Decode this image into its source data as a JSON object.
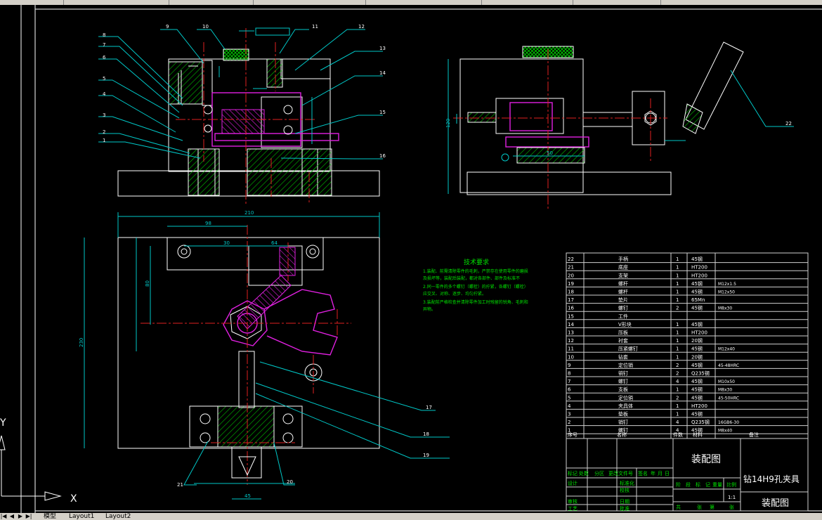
{
  "window": {
    "tabs": [
      "模型",
      "Layout1",
      "Layout2"
    ],
    "nav_arrows": [
      "|◀",
      "◀",
      "▶",
      "▶|"
    ]
  },
  "ucs": {
    "x_label": "X",
    "y_label": "Y"
  },
  "drawing": {
    "balloons_left": [
      "8",
      "7",
      "6",
      "5",
      "4",
      "3",
      "2",
      "1"
    ],
    "balloons_top": [
      "9",
      "10",
      "11",
      "12"
    ],
    "balloons_right": [
      "13",
      "14",
      "15",
      "16"
    ],
    "balloons_plan_right": [
      "17",
      "18",
      "19"
    ],
    "balloons_plan_bottom": [
      "21",
      "20"
    ],
    "balloon_side": "22",
    "dims": {
      "overall_width": "210",
      "overall_height": "230",
      "plan_dim_a": "98",
      "plan_dim_b": "30",
      "plan_dim_c": "64",
      "plan_dim_d": "80",
      "plan_dim_e": "45",
      "side_height": "120",
      "side_dim": "50"
    },
    "tech_requirements": {
      "title": "技术要求",
      "lines": [
        "1.装配、前需清除零件的毛刺，严禁存在使用零件的磨损",
        "及损坏等，装配后装配，都对各部件、部件及标准不",
        "2.同一零件的多个螺钉（螺栓）的拧紧，各螺钉（螺栓）",
        "应交叉、对称、逐步、均匀拧紧。",
        "3.装配前严格检查并清除零件加工时残留的锐角、毛刺和",
        "异物。"
      ]
    }
  },
  "bom": {
    "header": {
      "no": "序号",
      "name": "名称",
      "qty": "件数",
      "material": "材料",
      "remark": "备注"
    },
    "rows": [
      {
        "no": "22",
        "name": "手柄",
        "qty": "1",
        "material": "45钢",
        "remark": ""
      },
      {
        "no": "21",
        "name": "底座",
        "qty": "1",
        "material": "HT200",
        "remark": ""
      },
      {
        "no": "20",
        "name": "支架",
        "qty": "1",
        "material": "HT200",
        "remark": ""
      },
      {
        "no": "19",
        "name": "螺杆",
        "qty": "1",
        "material": "45钢",
        "remark": "M12x1.5"
      },
      {
        "no": "18",
        "name": "螺杆",
        "qty": "1",
        "material": "45钢",
        "remark": "M12x50"
      },
      {
        "no": "17",
        "name": "垫片",
        "qty": "1",
        "material": "65Mn",
        "remark": ""
      },
      {
        "no": "16",
        "name": "螺钉",
        "qty": "2",
        "material": "45钢",
        "remark": "M8x30"
      },
      {
        "no": "15",
        "name": "工件",
        "qty": "",
        "material": "",
        "remark": ""
      },
      {
        "no": "14",
        "name": "V形块",
        "qty": "1",
        "material": "45钢",
        "remark": ""
      },
      {
        "no": "13",
        "name": "压板",
        "qty": "1",
        "material": "HT200",
        "remark": ""
      },
      {
        "no": "12",
        "name": "衬套",
        "qty": "1",
        "material": "20钢",
        "remark": ""
      },
      {
        "no": "11",
        "name": "压紧螺钉",
        "qty": "1",
        "material": "45钢",
        "remark": "M12x40"
      },
      {
        "no": "10",
        "name": "钻套",
        "qty": "1",
        "material": "20钢",
        "remark": ""
      },
      {
        "no": "9",
        "name": "定位销",
        "qty": "2",
        "material": "45钢",
        "remark": "45-48HRC"
      },
      {
        "no": "8",
        "name": "销钉",
        "qty": "2",
        "material": "Q235钢",
        "remark": ""
      },
      {
        "no": "7",
        "name": "螺钉",
        "qty": "4",
        "material": "45钢",
        "remark": "M10x50"
      },
      {
        "no": "6",
        "name": "支板",
        "qty": "1",
        "material": "45钢",
        "remark": "M8x30"
      },
      {
        "no": "5",
        "name": "定位销",
        "qty": "2",
        "material": "45钢",
        "remark": "45-50HRC"
      },
      {
        "no": "4",
        "name": "夹具体",
        "qty": "1",
        "material": "HT200",
        "remark": ""
      },
      {
        "no": "3",
        "name": "垫板",
        "qty": "1",
        "material": "45钢",
        "remark": ""
      },
      {
        "no": "2",
        "name": "销钉",
        "qty": "4",
        "material": "Q235钢",
        "remark": "16GB6-30"
      },
      {
        "no": "1",
        "name": "螺钉",
        "qty": "4",
        "material": "45钢",
        "remark": "M8x40"
      }
    ]
  },
  "title_block": {
    "drawing_name": "装配图",
    "part_title": "钻14H9孔夹具",
    "drawing_name_2": "装配图",
    "scale": "1:1",
    "rev_headers": [
      "标记",
      "处数",
      "分区",
      "更改文件号",
      "签名",
      "年",
      "月",
      "日"
    ],
    "roles": [
      "设计",
      "审核",
      "工艺"
    ],
    "roles_mid": [
      "标准化",
      "批准",
      "日期",
      "校核"
    ],
    "stage_headers": [
      "阶",
      "段",
      "标",
      "记",
      "重量",
      "比例"
    ],
    "sheet": [
      "共",
      "张",
      "第",
      "张"
    ]
  },
  "colors": {
    "outline": "#ffffff",
    "dimension": "#00c8c8",
    "center": "#e02020",
    "hatch": "#00c800",
    "workpiece": "#e020e0",
    "tech_text": "#00e000",
    "bom_line": "#d0d0d0"
  }
}
